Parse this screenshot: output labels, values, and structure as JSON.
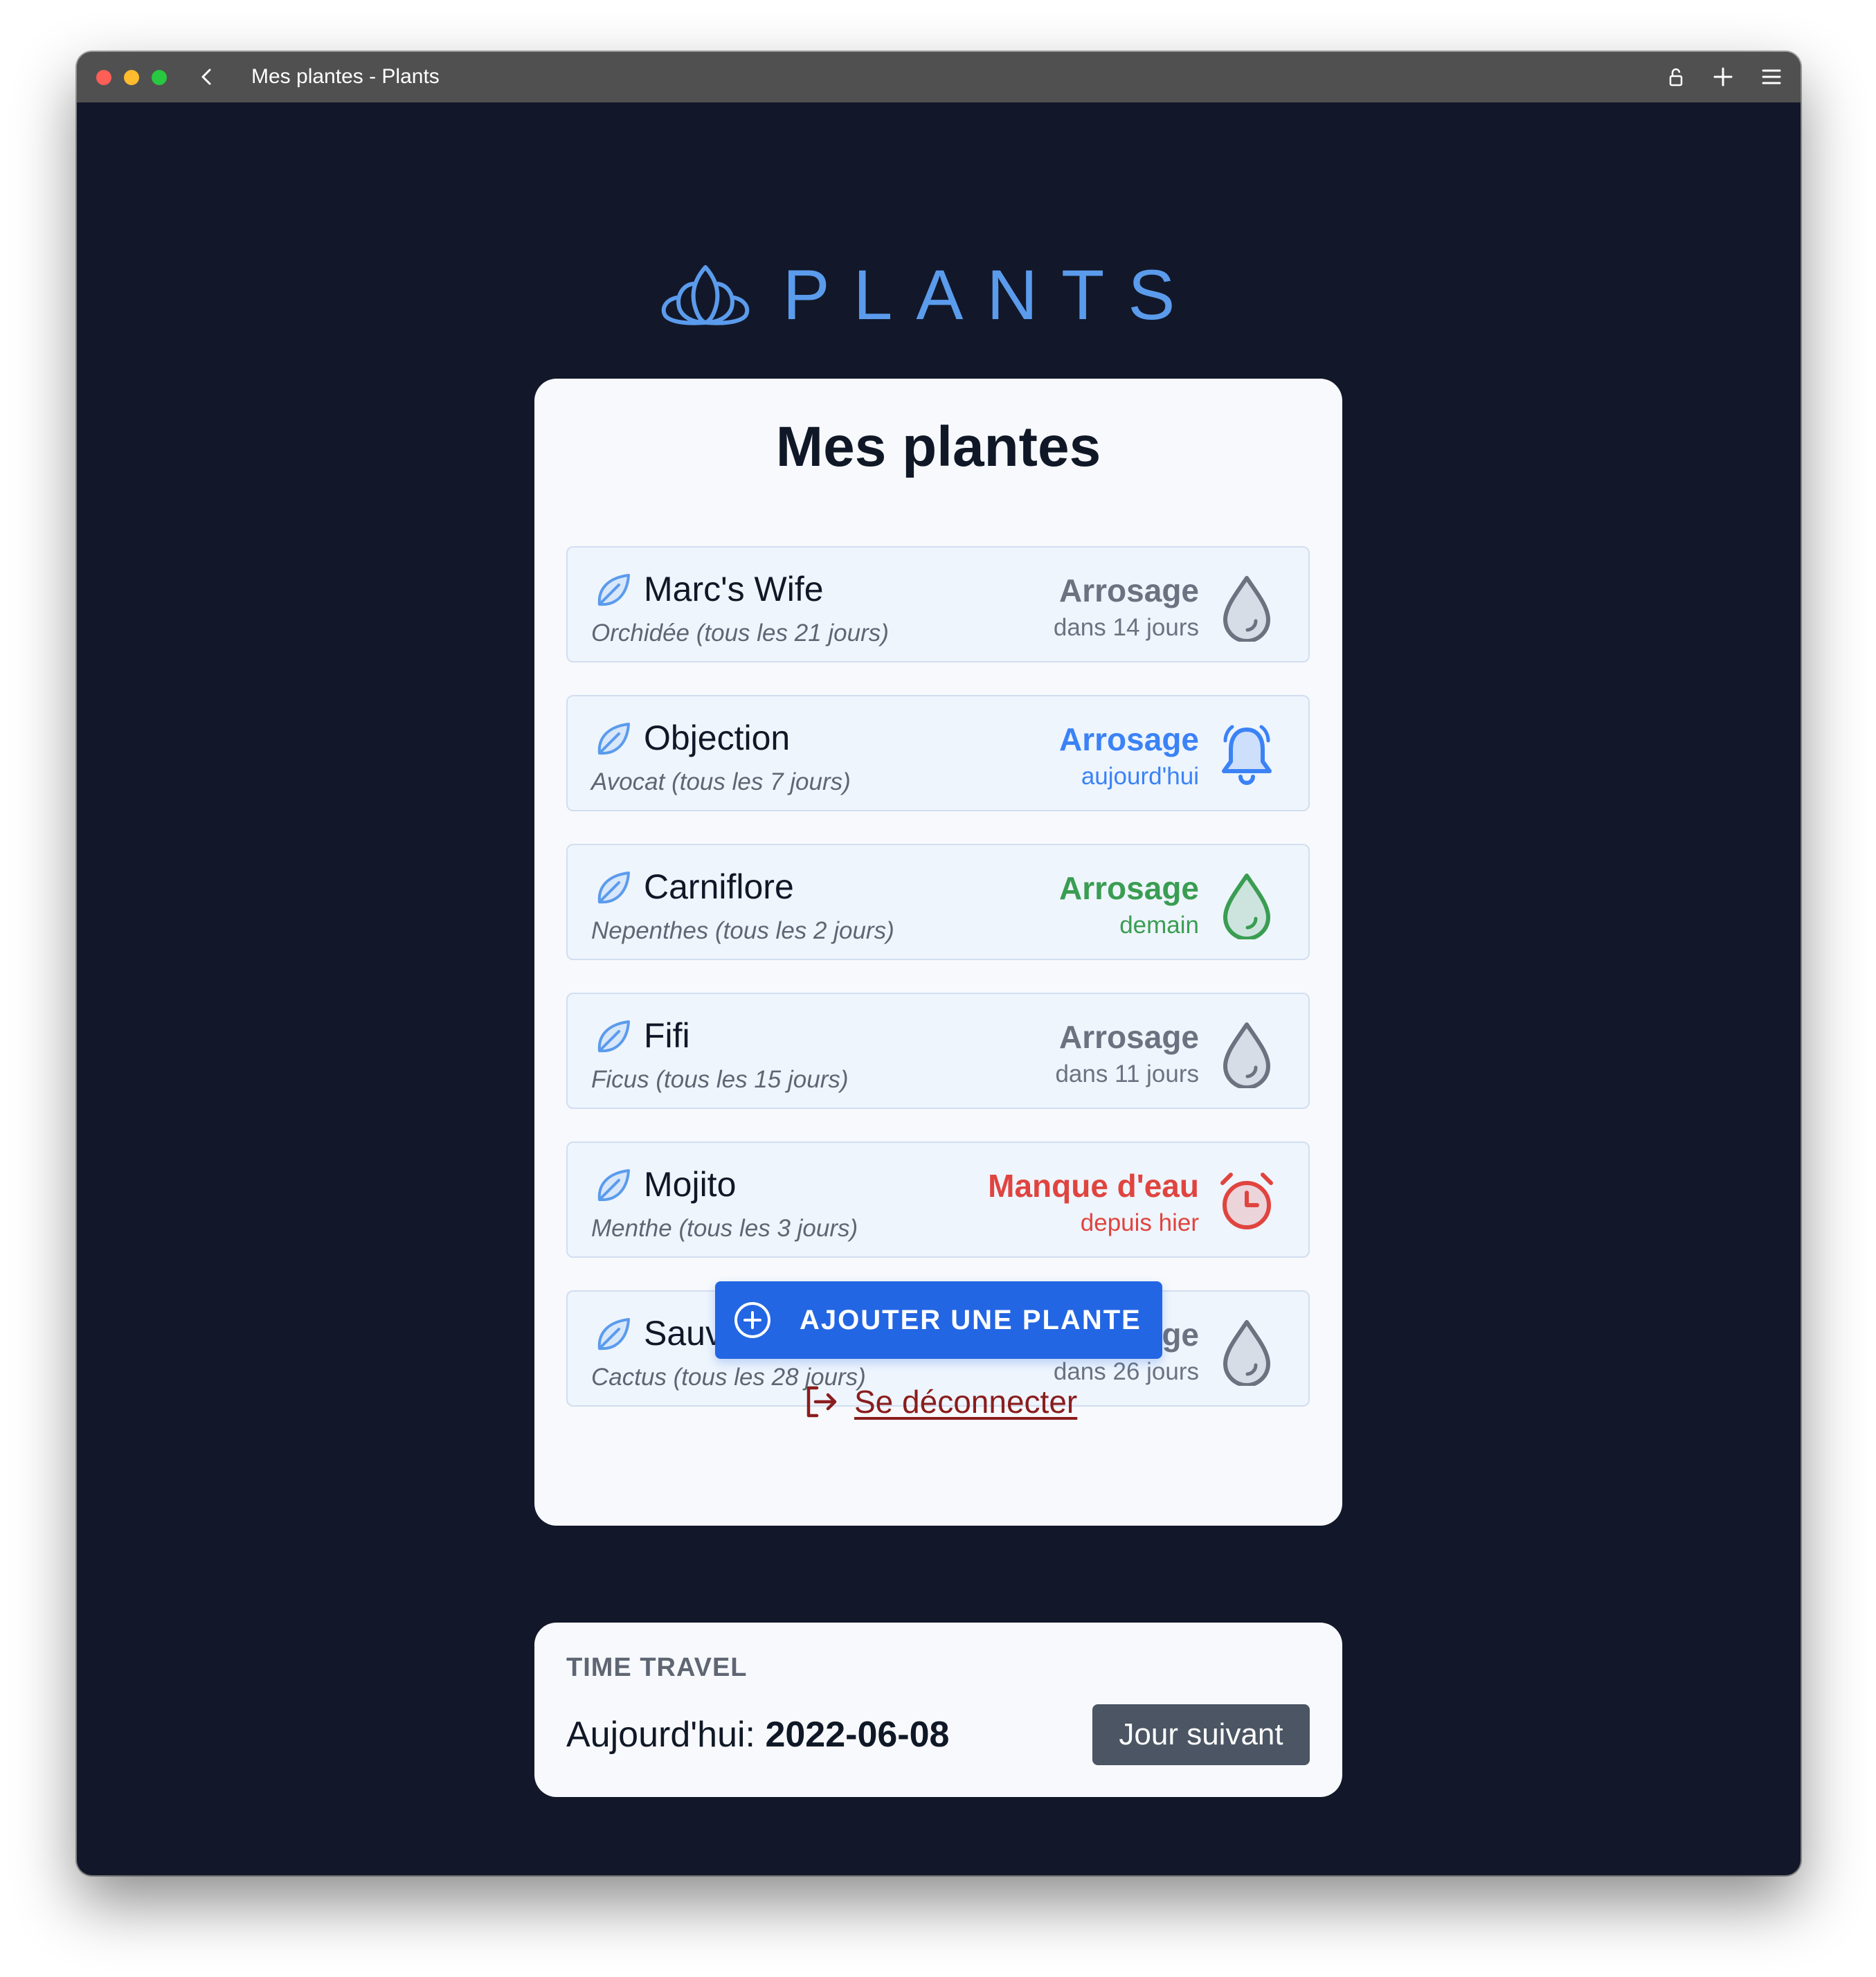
{
  "window": {
    "title": "Mes plantes - Plants",
    "traffic_lights": [
      "#ff5f57",
      "#febc2e",
      "#28c840"
    ]
  },
  "logo": {
    "text": "PLANTS",
    "icon": "lotus-icon",
    "color": "#5b9bec"
  },
  "main": {
    "heading": "Mes plantes",
    "plants": [
      {
        "name": "Marc's Wife",
        "info": "Orchidée (tous les 21 jours)",
        "status_title": "Arrosage",
        "status_sub": "dans 14 jours",
        "status_color": "#6b7280",
        "icon": "water-drop-icon"
      },
      {
        "name": "Objection",
        "info": "Avocat (tous les 7 jours)",
        "status_title": "Arrosage",
        "status_sub": "aujourd'hui",
        "status_color": "#3b82f6",
        "icon": "bell-icon"
      },
      {
        "name": "Carniflore",
        "info": "Nepenthes (tous les 2 jours)",
        "status_title": "Arrosage",
        "status_sub": "demain",
        "status_color": "#3a9d52",
        "icon": "water-drop-icon"
      },
      {
        "name": "Fifi",
        "info": "Ficus (tous les 15 jours)",
        "status_title": "Arrosage",
        "status_sub": "dans 11 jours",
        "status_color": "#6b7280",
        "icon": "water-drop-icon"
      },
      {
        "name": "Mojito",
        "info": "Menthe (tous les 3 jours)",
        "status_title": "Manque d'eau",
        "status_sub": "depuis hier",
        "status_color": "#e0443f",
        "icon": "alarm-clock-icon"
      },
      {
        "name": "Sauve qui pique",
        "info": "Cactus (tous les 28 jours)",
        "status_title": "Arrosage",
        "status_sub": "dans 26 jours",
        "status_color": "#6b7280",
        "icon": "water-drop-icon"
      }
    ],
    "add_button": "AJOUTER UNE PLANTE",
    "logout": "Se déconnecter"
  },
  "time_travel": {
    "title": "TIME TRAVEL",
    "today_label": "Aujourd'hui: ",
    "today_value": "2022-06-08",
    "next_button": "Jour suivant"
  }
}
